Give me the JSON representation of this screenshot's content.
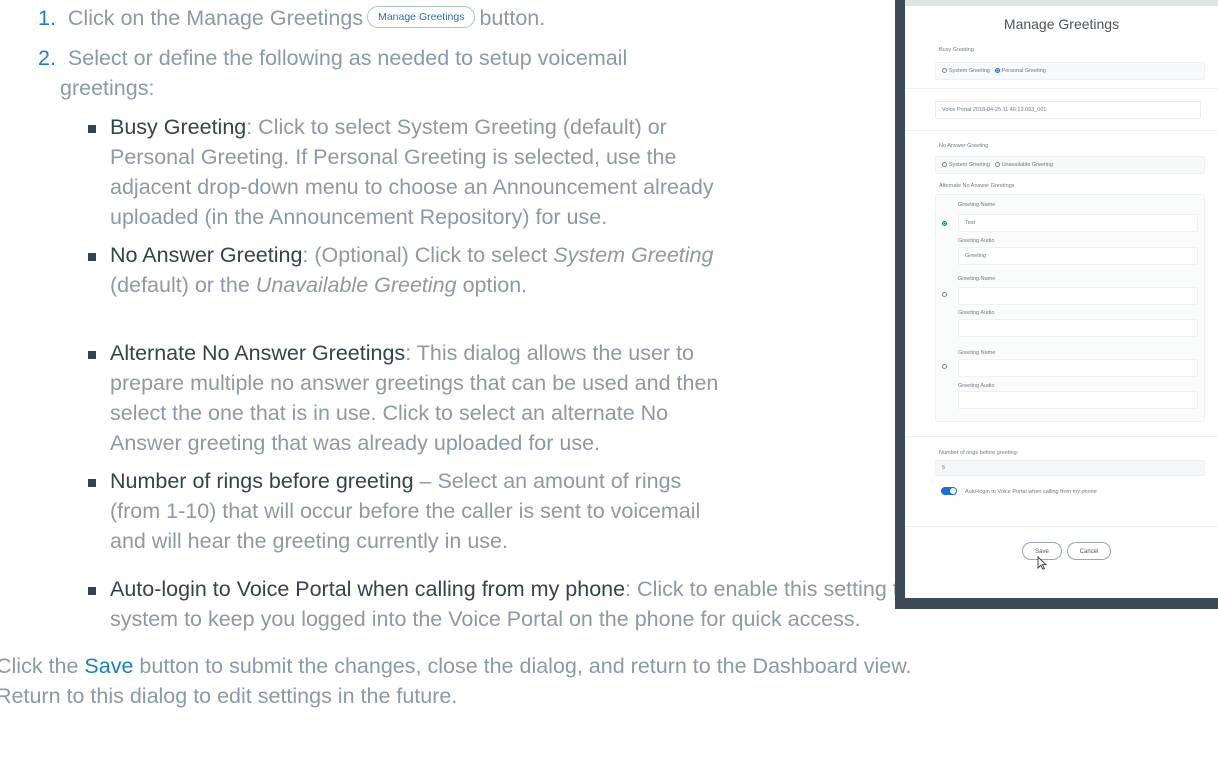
{
  "steps": {
    "s1": {
      "num": "1.",
      "before": "Click on the Manage Greetings",
      "button_label": "Manage Greetings",
      "after": "button."
    },
    "s2": {
      "num": "2.",
      "line1": "Select or define the following as needed to setup voicemail",
      "line2": "greetings:"
    }
  },
  "bullets": {
    "busy": {
      "term": "Busy Greeting",
      "l1": ": Click to select System Greeting (default) or",
      "l2": "Personal Greeting. If Personal Greeting is selected, use the",
      "l3": "adjacent drop-down menu to choose an Announcement already",
      "l4": "uploaded (in the Announcement Repository) for use."
    },
    "noanswer": {
      "term": "No Answer Greeting",
      "l1a": ": (Optional) Click to select ",
      "l1b": "System Greeting",
      "l2a": "(default) or the ",
      "l2b": "Unavailable Greeting",
      "l2c": " option."
    },
    "alternate": {
      "term": "Alternate No Answer Greetings",
      "l1": ": This dialog allows the user to",
      "l2": "prepare multiple no answer greetings that can be used and then",
      "l3": "select the one that is in use. Click to select an alternate No",
      "l4": "Answer greeting that was already uploaded for use."
    },
    "rings": {
      "term": "Number of rings before greeting",
      "l1": " – Select an amount of rings",
      "l2": "(from 1-10) that will occur before the caller is sent to voicemail",
      "l3": "and will hear the greeting currently in use."
    },
    "autologin": {
      "term": "Auto-login to Voice Portal when calling from my phone",
      "l1": ": Click to enable this setting to allow the",
      "l2": "system to keep you logged into the Voice Portal on the phone for quick access."
    }
  },
  "footer": {
    "p1a": "Click the ",
    "p1b": "Save",
    "p1c": " button to submit the changes, close the dialog, and return to the Dashboard view.",
    "p2": "Return to this dialog to edit settings in the future."
  },
  "dialog": {
    "title": "Manage Greetings",
    "busy_label": "Busy Greeting",
    "system_greeting": "System Greeting",
    "personal_greeting": "Personal Greeting",
    "busy_file": "Voice Portal 2018-04-25 11:46:13.093_001",
    "no_answer_label": "No Answer Greeting",
    "unavailable_greeting": "Unavailable Greeting",
    "alternate_label": "Alternate No Answer Greetings",
    "greeting_name_label": "Greeting Name",
    "greeting_audio_label": "Greeting Audio",
    "alt1_name": "Test",
    "alt1_audio": "Greeting",
    "rings_label": "Number of rings before greeting:",
    "rings_value": "5",
    "autologin_label": "Auto-login to Voice Portal when calling from my phone",
    "save": "Save",
    "cancel": "Cancel"
  },
  "colors": {
    "link_blue": "#1a7fc4",
    "body_gray": "#8a9aa6",
    "term_dark": "#2f4550",
    "toggle_blue": "#1a6fd0"
  }
}
